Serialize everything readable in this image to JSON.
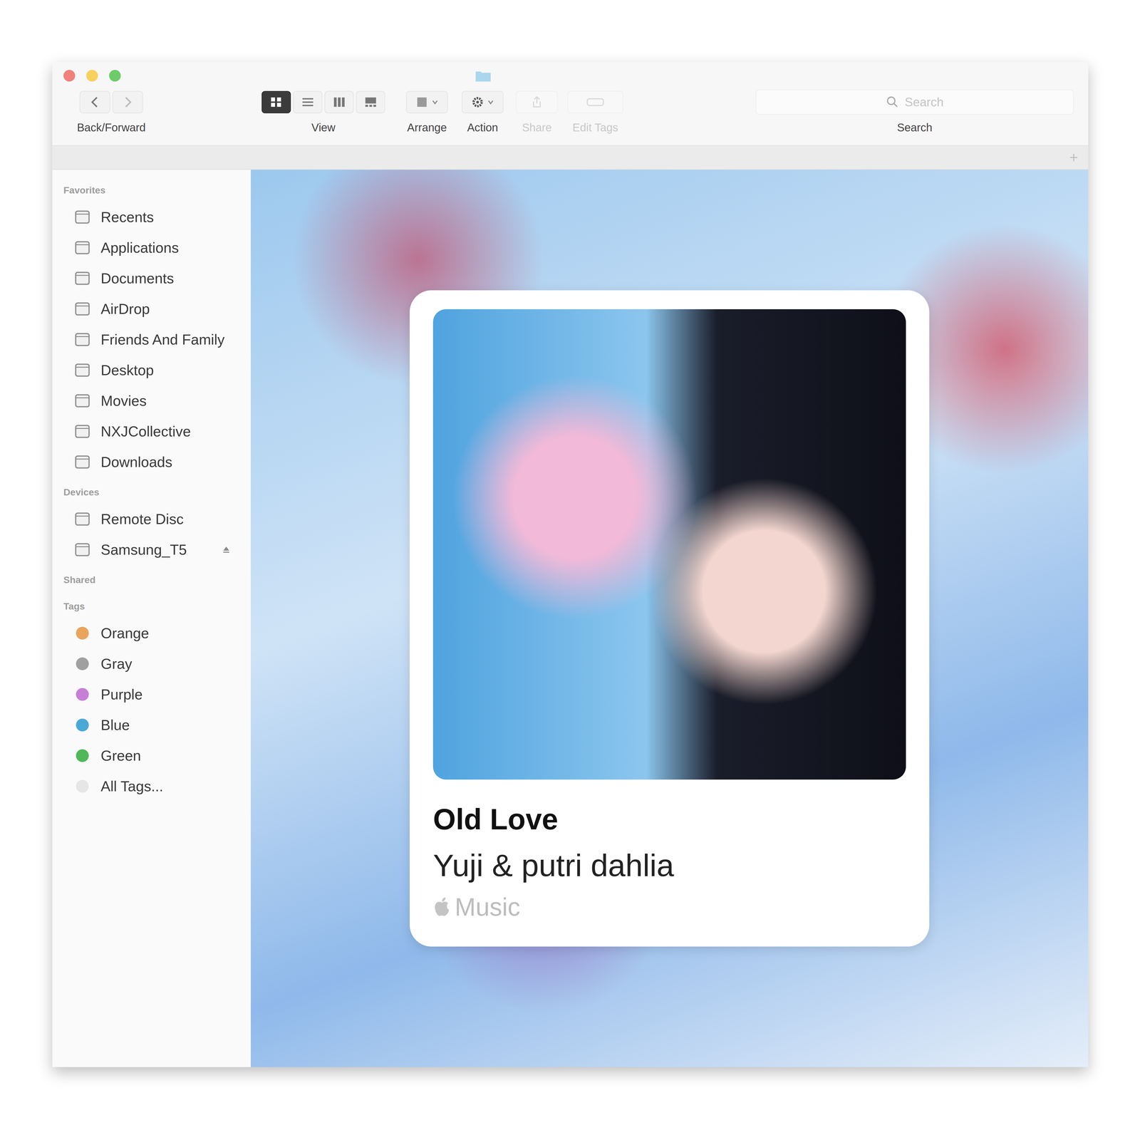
{
  "toolbar": {
    "items": [
      {
        "kind": "nav",
        "label": "Back/Forward",
        "disabled": false
      },
      {
        "kind": "view",
        "label": "View",
        "disabled": false
      },
      {
        "kind": "arrange",
        "label": "Arrange",
        "disabled": false
      },
      {
        "kind": "action",
        "label": "Action",
        "disabled": false
      },
      {
        "kind": "share",
        "label": "Share",
        "disabled": true
      },
      {
        "kind": "tags",
        "label": "Edit Tags",
        "disabled": true
      }
    ],
    "view_modes": [
      {
        "selected": true
      },
      {
        "selected": false
      },
      {
        "selected": false
      },
      {
        "selected": false
      }
    ],
    "search": {
      "label": "Search",
      "placeholder": "Search"
    }
  },
  "sidebar": {
    "sections": [
      {
        "title": "Favorites",
        "items": [
          {
            "label": "Recents"
          },
          {
            "label": "Applications"
          },
          {
            "label": "Documents"
          },
          {
            "label": "AirDrop"
          },
          {
            "label": "Friends And Family"
          },
          {
            "label": "Desktop"
          },
          {
            "label": "Movies"
          },
          {
            "label": "NXJCollective"
          },
          {
            "label": "Downloads"
          }
        ]
      },
      {
        "title": "Devices",
        "items": [
          {
            "label": "Remote Disc",
            "ejectable": false
          },
          {
            "label": "Samsung_T5",
            "ejectable": true
          }
        ]
      },
      {
        "title": "Shared",
        "items": []
      },
      {
        "title": "Tags",
        "items": [
          {
            "label": "Orange",
            "color": "#e9a45e"
          },
          {
            "label": "Gray",
            "color": "#a0a0a0"
          },
          {
            "label": "Purple",
            "color": "#c77fd6"
          },
          {
            "label": "Blue",
            "color": "#49a9d6"
          },
          {
            "label": "Green",
            "color": "#4fb85a"
          },
          {
            "label": "All Tags...",
            "color": "#e6e6e6"
          }
        ]
      }
    ]
  },
  "card": {
    "title": "Old Love",
    "artist": "Yuji & putri dahlia",
    "source": "Music"
  }
}
